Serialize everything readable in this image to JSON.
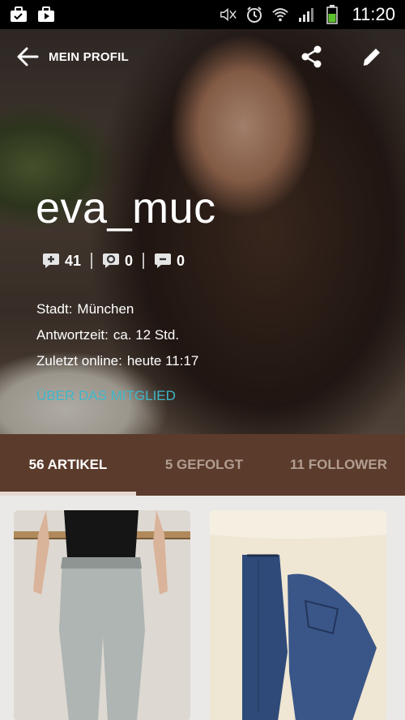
{
  "status_bar": {
    "time": "11:20",
    "left_icons": [
      "briefcase-check-icon",
      "play-store-icon"
    ],
    "right_icons": [
      "mute-icon",
      "alarm-icon",
      "wifi-icon",
      "signal-icon",
      "battery-icon"
    ]
  },
  "header": {
    "title": "MEIN PROFIL",
    "back_icon": "arrow-left-icon",
    "share_icon": "share-icon",
    "edit_icon": "pencil-icon"
  },
  "profile": {
    "username": "eva_muc",
    "stats": [
      {
        "icon": "comment-plus-icon",
        "value": "41"
      },
      {
        "icon": "comment-circle-icon",
        "value": "0"
      },
      {
        "icon": "comment-minus-icon",
        "value": "0"
      }
    ],
    "city_label": "Stadt:",
    "city_value": "München",
    "response_label": "Antwortzeit:",
    "response_value": "ca. 12 Std.",
    "last_online_label": "Zuletzt online:",
    "last_online_value": "heute 11:17",
    "about_link": "ÜBER DAS MITGLIED"
  },
  "tabs": [
    {
      "label": "56 ARTIKEL",
      "active": true
    },
    {
      "label": "5 GEFOLGT",
      "active": false
    },
    {
      "label": "11 FOLLOWER",
      "active": false
    }
  ],
  "colors": {
    "tab_bar": "#5b3b2b",
    "link": "#3fb7c9",
    "grid_bg": "#ebe9e7"
  }
}
